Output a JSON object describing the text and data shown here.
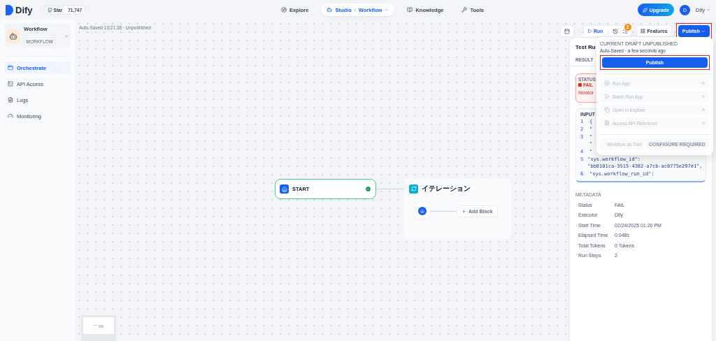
{
  "header": {
    "logo": "Dify",
    "github": {
      "label": "Star",
      "count": "71,747"
    },
    "nav": [
      {
        "kind": "explore",
        "label": "Explore",
        "selected": false
      },
      {
        "kind": "studio",
        "label": "Studio",
        "separator": "/",
        "sub": "Workflow",
        "selected": true
      },
      {
        "kind": "knowledge",
        "label": "Knowledge",
        "selected": false
      },
      {
        "kind": "tools",
        "label": "Tools",
        "selected": false
      }
    ],
    "upgrade": "Upgrade",
    "user": {
      "initial": "D",
      "name": "Dify"
    }
  },
  "sidebar": {
    "app": {
      "name": "Workflow",
      "badge": "WORKFLOW"
    },
    "items": [
      {
        "kind": "orchestrate",
        "label": "Orchestrate",
        "selected": true
      },
      {
        "kind": "api",
        "label": "API Access",
        "selected": false
      },
      {
        "kind": "logs",
        "label": "Logs",
        "selected": false
      },
      {
        "kind": "monitoring",
        "label": "Monitoring",
        "selected": false
      }
    ]
  },
  "canvas": {
    "save_status": "Auto-Saved 13:21:38 · Unpublished",
    "toolbar": {
      "run": "Run",
      "checklist_count": "2",
      "features": "Features",
      "publish": "Publish"
    },
    "start_node": {
      "title": "START",
      "succeeded": true
    },
    "iteration_node": {
      "title": "イテレーション",
      "add_block": "Add Block"
    },
    "test_run": {
      "title": "Test Ru",
      "tabs": [
        {
          "label": "RESULT",
          "selected": true
        }
      ],
      "status": {
        "label": "STATUS",
        "value": "FAIL",
        "message": "Iterator"
      },
      "input": {
        "title": "INPUT",
        "lines": [
          {
            "number": "1",
            "text": [
              "{"
            ]
          },
          {
            "number": "2",
            "text": [
              "\""
            ]
          },
          {
            "number": "3",
            "text": [
              "\"",
              "\""
            ]
          },
          {
            "number": "4",
            "text": [
              "\""
            ]
          },
          {
            "number": "5",
            "text": [
              "\"sys.workflow_id\":",
              "\"bb8101ca-3515-4382-a7cb-ac8775e297e1\","
            ]
          },
          {
            "number": "6",
            "text": [
              "\"sys.workflow_run_id\":"
            ]
          }
        ]
      },
      "metadata": {
        "title": "METADATA",
        "rows": [
          {
            "label": "Status",
            "value": "FAIL"
          },
          {
            "label": "Executor",
            "value": "Dify"
          },
          {
            "label": "Start Time",
            "value": "02/24/2025 01:20 PM"
          },
          {
            "label": "Elapsed Time",
            "value": "0.048s"
          },
          {
            "label": "Total Tokens",
            "value": "0 Tokens"
          },
          {
            "label": "Run Steps",
            "value": "2"
          }
        ]
      }
    },
    "publish_menu": {
      "heading": "CURRENT DRAFT UNPUBLISHED",
      "saved": "Auto-Saved · a few seconds ago",
      "publish": "Publish",
      "items": [
        {
          "kind": "run",
          "label": "Run App",
          "disabled": true
        },
        {
          "kind": "batch",
          "label": "Batch Run App",
          "disabled": true
        },
        {
          "kind": "explore",
          "label": "Open in Explore",
          "disabled": true
        },
        {
          "kind": "api",
          "label": "Access API Reference",
          "disabled": true
        },
        {
          "kind": "tool",
          "label": "Workflow as Tool",
          "badge": "CONFIGURE REQUIRED",
          "disabled": true
        }
      ]
    }
  }
}
